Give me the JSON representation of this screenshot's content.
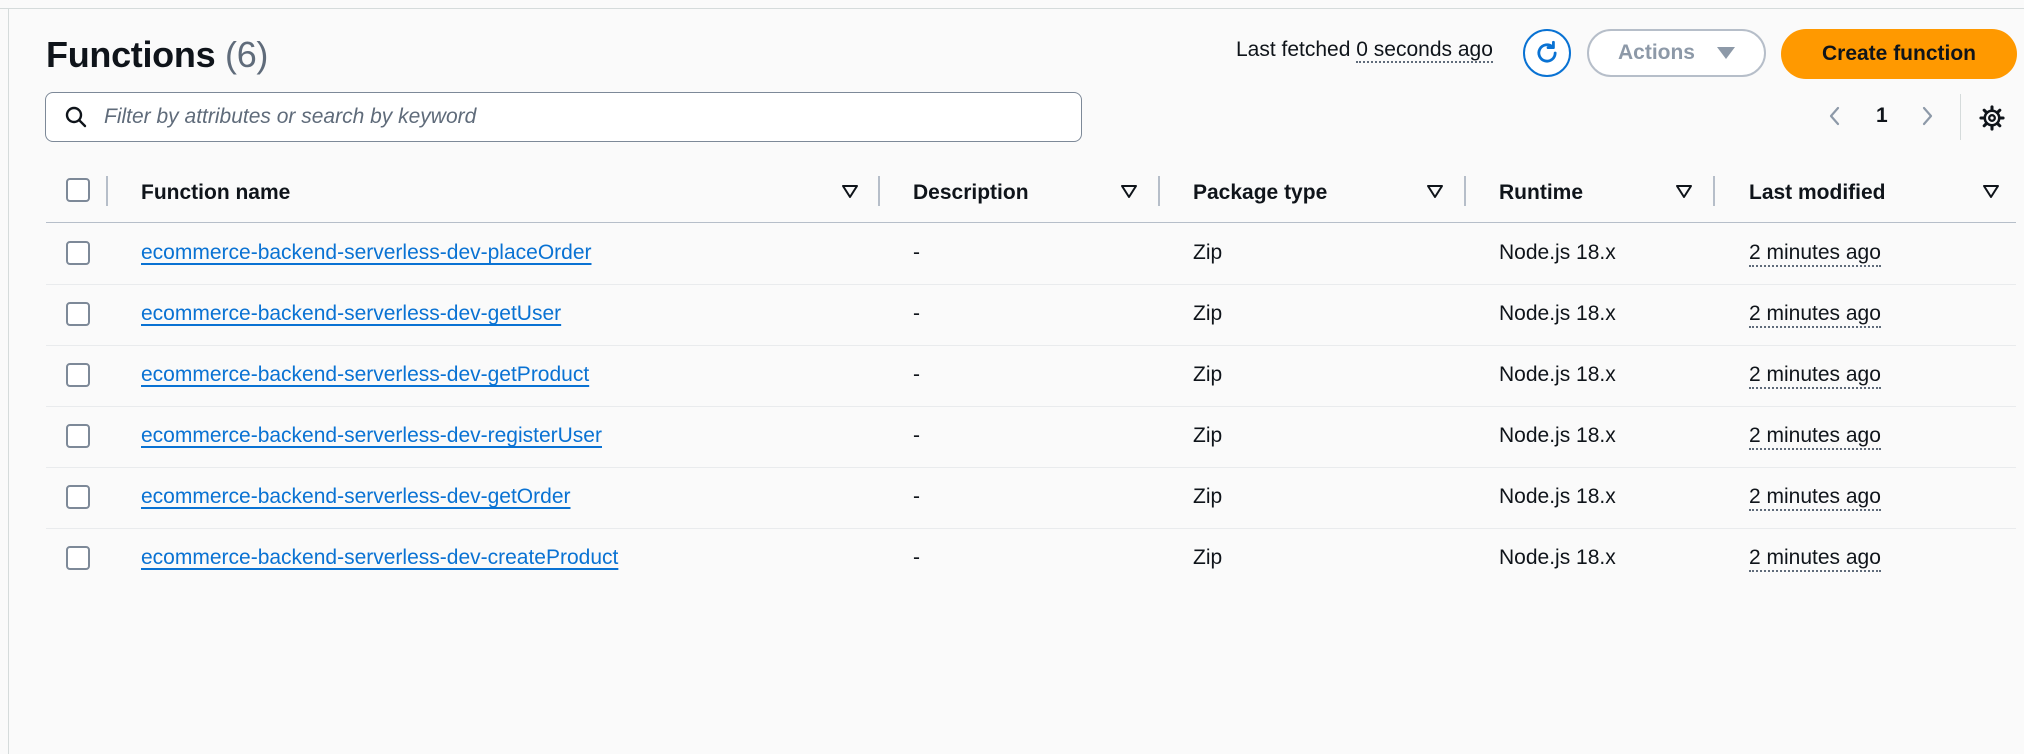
{
  "header": {
    "title": "Functions",
    "count": "(6)",
    "last_fetched_label": "Last fetched",
    "last_fetched_value": "0 seconds ago",
    "actions_label": "Actions",
    "create_label": "Create function"
  },
  "search": {
    "placeholder": "Filter by attributes or search by keyword"
  },
  "pagination": {
    "current_page": "1"
  },
  "table": {
    "columns": [
      "Function name",
      "Description",
      "Package type",
      "Runtime",
      "Last modified"
    ],
    "rows": [
      {
        "name": "ecommerce-backend-serverless-dev-placeOrder",
        "description": "-",
        "package_type": "Zip",
        "runtime": "Node.js 18.x",
        "last_modified": "2 minutes ago"
      },
      {
        "name": "ecommerce-backend-serverless-dev-getUser",
        "description": "-",
        "package_type": "Zip",
        "runtime": "Node.js 18.x",
        "last_modified": "2 minutes ago"
      },
      {
        "name": "ecommerce-backend-serverless-dev-getProduct",
        "description": "-",
        "package_type": "Zip",
        "runtime": "Node.js 18.x",
        "last_modified": "2 minutes ago"
      },
      {
        "name": "ecommerce-backend-serverless-dev-registerUser",
        "description": "-",
        "package_type": "Zip",
        "runtime": "Node.js 18.x",
        "last_modified": "2 minutes ago"
      },
      {
        "name": "ecommerce-backend-serverless-dev-getOrder",
        "description": "-",
        "package_type": "Zip",
        "runtime": "Node.js 18.x",
        "last_modified": "2 minutes ago"
      },
      {
        "name": "ecommerce-backend-serverless-dev-createProduct",
        "description": "-",
        "package_type": "Zip",
        "runtime": "Node.js 18.x",
        "last_modified": "2 minutes ago"
      }
    ]
  },
  "icons": {
    "search": "search-icon",
    "refresh": "refresh-icon",
    "actions_caret": "caret-down-icon",
    "prev": "chevron-left-icon",
    "next": "chevron-right-icon",
    "settings": "gear-icon",
    "sort": "sort-caret-icon"
  },
  "colors": {
    "primary": "#ff9900",
    "link": "#0972d3",
    "text": "#0f141a",
    "muted": "#5f6b7a",
    "disabled": "#8d99a8",
    "background": "#fafafa"
  }
}
